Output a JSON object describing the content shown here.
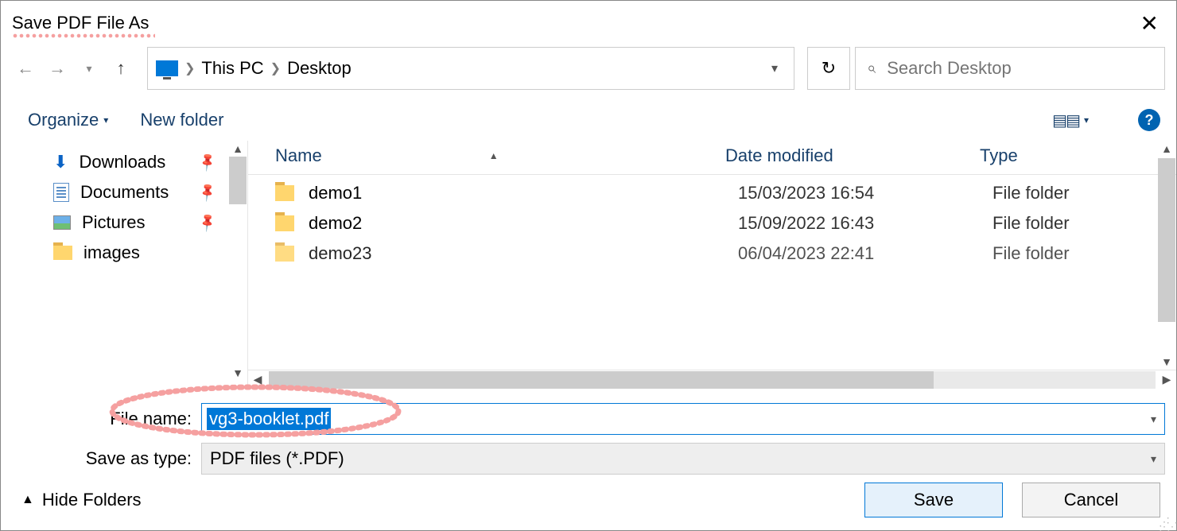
{
  "title": "Save PDF File As",
  "breadcrumb": {
    "root": "This PC",
    "leaf": "Desktop"
  },
  "search": {
    "placeholder": "Search Desktop"
  },
  "toolbar": {
    "organize": "Organize",
    "new_folder": "New folder"
  },
  "sidebar": {
    "items": [
      {
        "label": "Downloads",
        "icon": "download"
      },
      {
        "label": "Documents",
        "icon": "document"
      },
      {
        "label": "Pictures",
        "icon": "picture"
      },
      {
        "label": "images",
        "icon": "folder"
      }
    ]
  },
  "columns": {
    "name": "Name",
    "date": "Date modified",
    "type": "Type"
  },
  "files": [
    {
      "name": "demo1",
      "date": "15/03/2023 16:54",
      "type": "File folder"
    },
    {
      "name": "demo2",
      "date": "15/09/2022 16:43",
      "type": "File folder"
    },
    {
      "name": "demo23",
      "date": "06/04/2023 22:41",
      "type": "File folder"
    }
  ],
  "form": {
    "file_name_label": "File name:",
    "file_name_value": "vg3-booklet.pdf",
    "save_type_label": "Save as type:",
    "save_type_value": "PDF files (*.PDF)"
  },
  "footer": {
    "hide_folders": "Hide Folders",
    "save": "Save",
    "cancel": "Cancel"
  }
}
